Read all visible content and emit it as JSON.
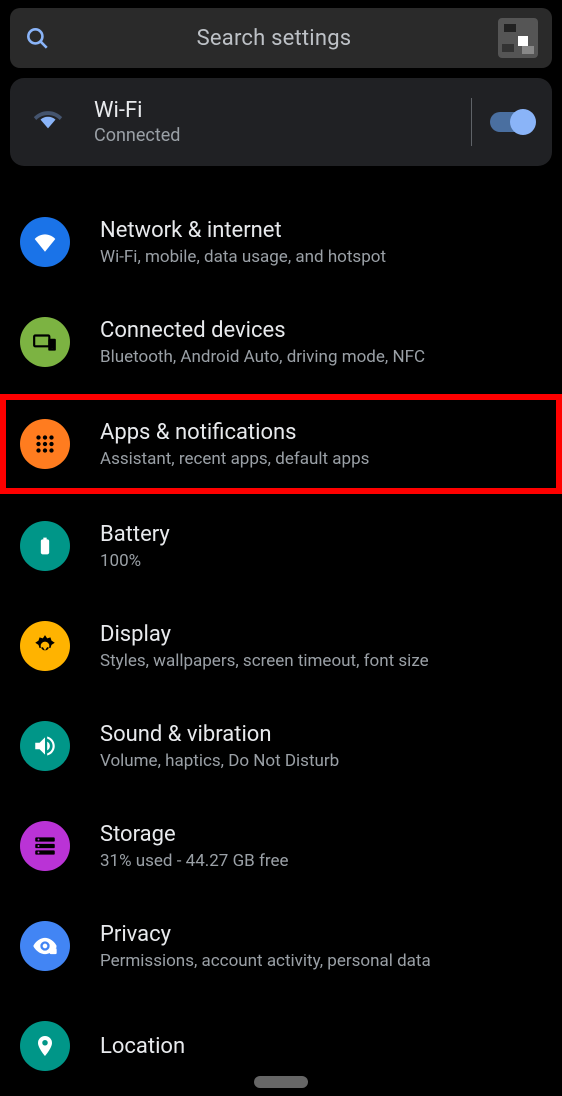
{
  "search": {
    "placeholder": "Search settings"
  },
  "wifi": {
    "title": "Wi-Fi",
    "status": "Connected",
    "enabled": true
  },
  "items": [
    {
      "icon": "wifi",
      "bg": "bg-blue",
      "title": "Network & internet",
      "sub": "Wi-Fi, mobile, data usage, and hotspot",
      "hl": false
    },
    {
      "icon": "devices",
      "bg": "bg-green",
      "title": "Connected devices",
      "sub": "Bluetooth, Android Auto, driving mode, NFC",
      "hl": false
    },
    {
      "icon": "apps",
      "bg": "bg-orange",
      "title": "Apps & notifications",
      "sub": "Assistant, recent apps, default apps",
      "hl": true
    },
    {
      "icon": "battery",
      "bg": "bg-teal",
      "title": "Battery",
      "sub": "100%",
      "hl": false
    },
    {
      "icon": "display",
      "bg": "bg-amber",
      "title": "Display",
      "sub": "Styles, wallpapers, screen timeout, font size",
      "hl": false
    },
    {
      "icon": "sound",
      "bg": "bg-teal",
      "title": "Sound & vibration",
      "sub": "Volume, haptics, Do Not Disturb",
      "hl": false
    },
    {
      "icon": "storage",
      "bg": "bg-purple",
      "title": "Storage",
      "sub": "31% used - 44.27 GB free",
      "hl": false
    },
    {
      "icon": "privacy",
      "bg": "bg-lightblue",
      "title": "Privacy",
      "sub": "Permissions, account activity, personal data",
      "hl": false
    },
    {
      "icon": "location",
      "bg": "bg-teal",
      "title": "Location",
      "sub": "",
      "hl": false
    }
  ]
}
